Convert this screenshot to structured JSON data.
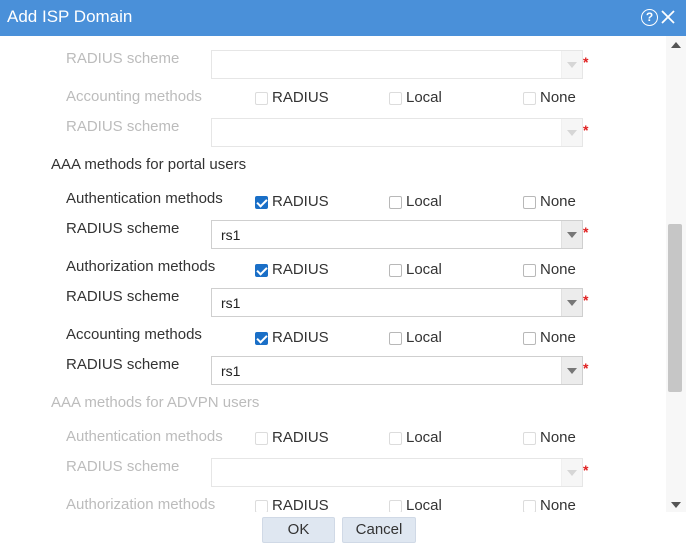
{
  "dialog": {
    "title": "Add ISP Domain",
    "help_icon": "question-circle-icon",
    "close_icon": "close-icon"
  },
  "form": {
    "required_mark": "*",
    "rows": {
      "r1_label": "RADIUS scheme",
      "r2_label": "Accounting methods",
      "r2_opts": [
        "RADIUS",
        "Local",
        "None"
      ],
      "r3_label": "RADIUS scheme",
      "portal_section": "AAA methods for portal users",
      "r5_label": "Authentication methods",
      "r5_opts": [
        "RADIUS",
        "Local",
        "None"
      ],
      "r6_label": "RADIUS scheme",
      "r6_value": "rs1",
      "r7_label": "Authorization methods",
      "r7_opts": [
        "RADIUS",
        "Local",
        "None"
      ],
      "r8_label": "RADIUS scheme",
      "r8_value": "rs1",
      "r9_label": "Accounting methods",
      "r9_opts": [
        "RADIUS",
        "Local",
        "None"
      ],
      "r10_label": "RADIUS scheme",
      "r10_value": "rs1",
      "advpn_section": "AAA methods for ADVPN users",
      "r12_label": "Authentication methods",
      "r12_opts": [
        "RADIUS",
        "Local",
        "None"
      ],
      "r13_label": "RADIUS scheme",
      "r14_label": "Authorization methods",
      "r14_opts": [
        "RADIUS",
        "Local",
        "None"
      ]
    },
    "checked": {
      "portal_authentication": "RADIUS",
      "portal_authorization": "RADIUS",
      "portal_accounting": "RADIUS"
    }
  },
  "footer": {
    "ok_label": "OK",
    "cancel_label": "Cancel"
  },
  "colors": {
    "titlebar": "#4a90d9",
    "checkbox_checked": "#1a6fc7",
    "required": "#e02020",
    "button_bg": "#dfe7f1"
  }
}
